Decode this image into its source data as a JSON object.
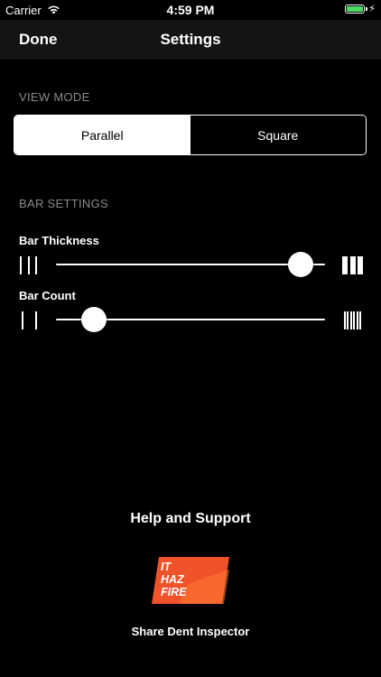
{
  "status_bar": {
    "carrier": "Carrier",
    "time": "4:59 PM",
    "battery_color": "#4cd964"
  },
  "nav": {
    "done_label": "Done",
    "title": "Settings"
  },
  "view_mode": {
    "header": "VIEW MODE",
    "options": [
      "Parallel",
      "Square"
    ],
    "selected": "Parallel"
  },
  "bar_settings": {
    "header": "BAR SETTINGS",
    "thickness": {
      "label": "Bar Thickness",
      "value": 0.91,
      "min_icon": "thin-bars-icon",
      "max_icon": "thick-bars-icon"
    },
    "count": {
      "label": "Bar Count",
      "value": 0.14,
      "min_icon": "few-bars-icon",
      "max_icon": "many-bars-icon"
    }
  },
  "footer": {
    "help_title": "Help and Support",
    "logo_lines": [
      "IT",
      "HAZ",
      "FIRE"
    ],
    "logo_color": "#f0532a",
    "share_label": "Share Dent Inspector"
  }
}
